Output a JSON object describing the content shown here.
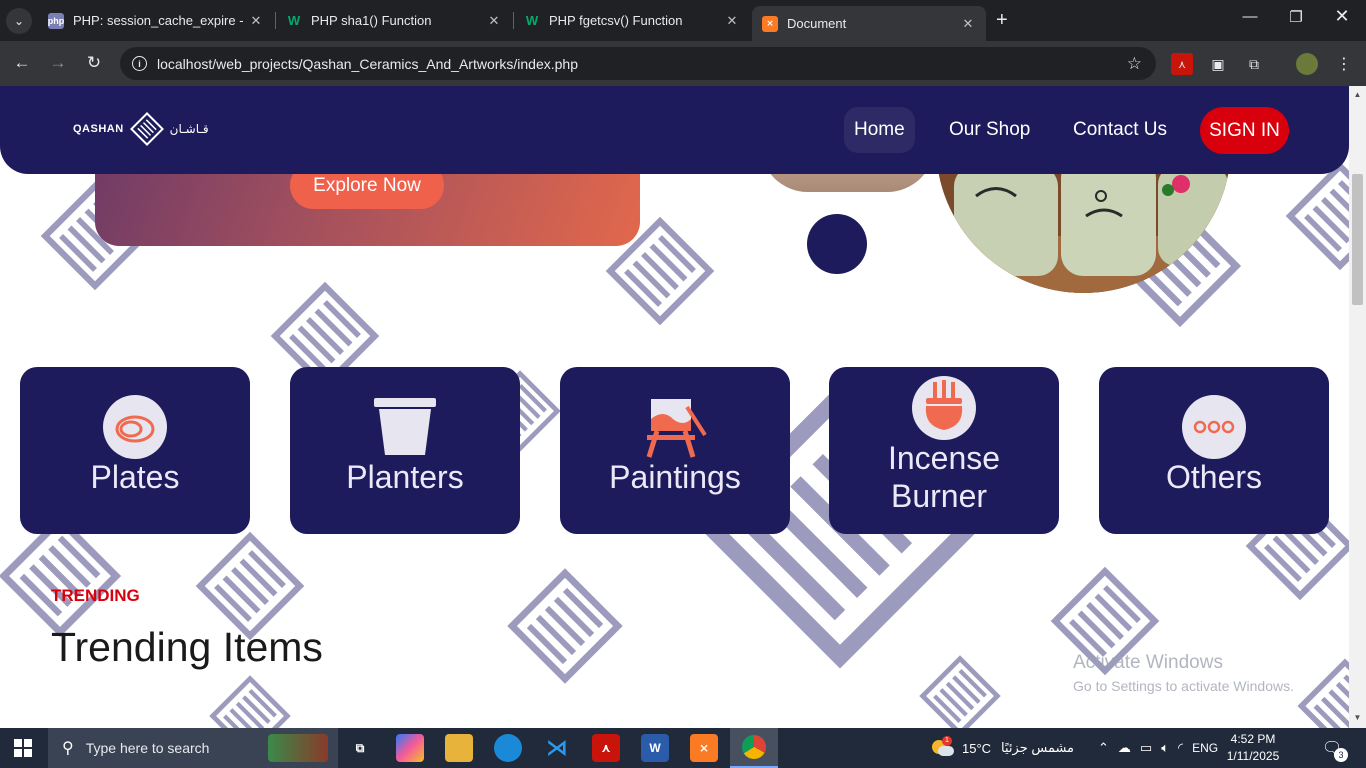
{
  "browser": {
    "tabs": [
      {
        "title": "PHP: session_cache_expire - Ma",
        "favicon": "php-icon",
        "active": false
      },
      {
        "title": "PHP sha1() Function",
        "favicon": "w3schools-icon",
        "active": false
      },
      {
        "title": "PHP fgetcsv() Function",
        "favicon": "w3schools-icon",
        "active": false
      },
      {
        "title": "Document",
        "favicon": "xampp-icon",
        "active": true
      }
    ],
    "url": "localhost/web_projects/Qashan_Ceramics_And_Artworks/index.php"
  },
  "site": {
    "logo_text": "QASHAN",
    "logo_arabic": "قـاشـان",
    "nav": [
      {
        "label": "Home",
        "active": true
      },
      {
        "label": "Our Shop",
        "active": false
      },
      {
        "label": "Contact Us",
        "active": false
      }
    ],
    "signin_label": "SIGN IN",
    "colors": {
      "primary": "#1e1b5c",
      "accent": "#d8000c",
      "cta": "#f0614c"
    }
  },
  "hero": {
    "cta_label": "Explore Now"
  },
  "categories": [
    {
      "label": "Plates",
      "icon": "plate-icon"
    },
    {
      "label": "Planters",
      "icon": "planter-icon"
    },
    {
      "label": "Paintings",
      "icon": "easel-icon"
    },
    {
      "label_line1": "Incense",
      "label_line2": "Burner",
      "icon": "incense-burner-icon"
    },
    {
      "label": "Others",
      "icon": "more-dots-icon"
    }
  ],
  "trending": {
    "tag": "TRENDING",
    "title": "Trending Items"
  },
  "watermark": {
    "line1": "Activate Windows",
    "line2": "Go to Settings to activate Windows."
  },
  "taskbar": {
    "search_placeholder": "Type here to search",
    "weather_temp": "15°C",
    "weather_text": "مشمس جزئيًا",
    "language": "ENG",
    "time": "4:52 PM",
    "date": "1/11/2025",
    "notifications": "3",
    "weather_badge": "1"
  }
}
